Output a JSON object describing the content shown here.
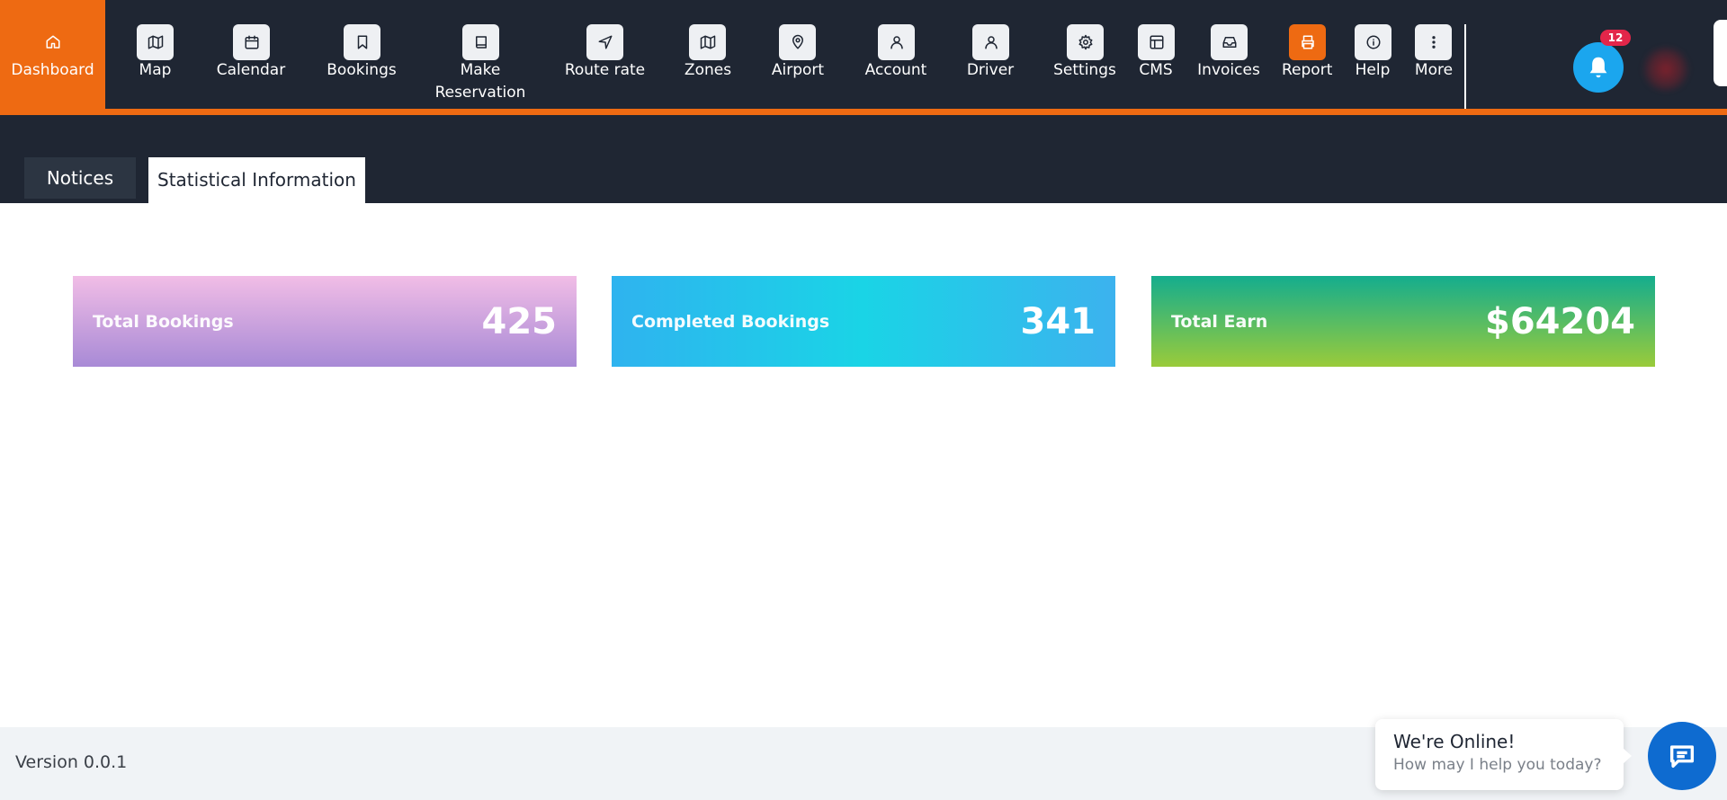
{
  "nav": {
    "items": [
      {
        "label": "Dashboard",
        "icon": "home-icon"
      },
      {
        "label": "Map",
        "icon": "map-icon"
      },
      {
        "label": "Calendar",
        "icon": "calendar-icon"
      },
      {
        "label": "Bookings",
        "icon": "bookmark-icon"
      },
      {
        "label": "Make\nReservation",
        "icon": "book-icon"
      },
      {
        "label": "Route rate",
        "icon": "navigation-icon"
      },
      {
        "label": "Zones",
        "icon": "map-icon"
      },
      {
        "label": "Airport",
        "icon": "map-pin-icon"
      },
      {
        "label": "Account",
        "icon": "user-icon"
      },
      {
        "label": "Driver",
        "icon": "user-icon"
      },
      {
        "label": "Settings",
        "icon": "gear-icon"
      },
      {
        "label": "CMS",
        "icon": "layout-icon"
      },
      {
        "label": "Invoices",
        "icon": "inbox-icon"
      },
      {
        "label": "Report",
        "icon": "printer-icon"
      },
      {
        "label": "Help",
        "icon": "info-icon"
      },
      {
        "label": "More",
        "icon": "more-vertical-icon"
      }
    ],
    "active": "Dashboard",
    "notifications_count": "12"
  },
  "tabs": {
    "notices": "Notices",
    "statistical": "Statistical Information",
    "active": "Statistical Information"
  },
  "stats": {
    "total_bookings": {
      "label": "Total Bookings",
      "value": "425"
    },
    "completed_bookings": {
      "label": "Completed Bookings",
      "value": "341"
    },
    "total_earn": {
      "label": "Total Earn",
      "value": "$64204"
    }
  },
  "footer": {
    "version": "Version 0.0.1"
  },
  "chat": {
    "title": "We're Online!",
    "subtitle": "How may I help you today?"
  },
  "colors": {
    "nav_bg": "#1f2633",
    "accent": "#ee6a12",
    "bell": "#1ba6ee",
    "badge": "#e3264a",
    "chat_button": "#0e6bd0"
  }
}
